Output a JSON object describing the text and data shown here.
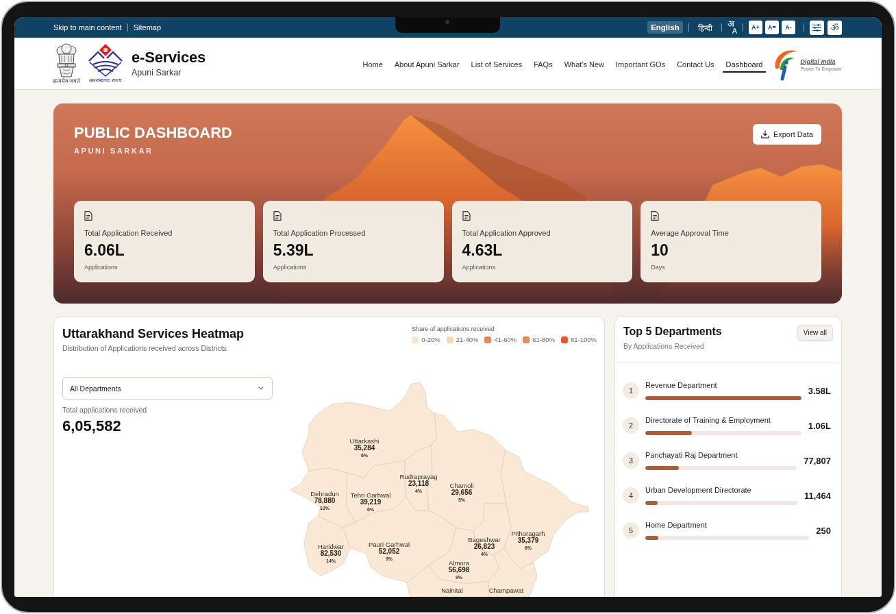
{
  "top_bar": {
    "links": [
      "Skip to main content",
      "Sitemap"
    ],
    "languages": [
      {
        "label": "English",
        "selected": true
      },
      {
        "label": "हिन्दी",
        "selected": false
      }
    ],
    "script_toggle": [
      "अ",
      "A"
    ],
    "font_size_buttons": [
      "A+",
      "A=",
      "A-"
    ],
    "accessibility_glyph": "ॐ"
  },
  "header": {
    "emblem_motto": "सत्यमेव जयते",
    "state_logo_caption": "उत्तराखण्ड राज्य",
    "title": "e-Services",
    "subtitle": "Apuni Sarkar",
    "nav": [
      {
        "label": "Home",
        "selected": false
      },
      {
        "label": "About Apuni Sarkar",
        "selected": false
      },
      {
        "label": "List of Services",
        "selected": false
      },
      {
        "label": "FAQs",
        "selected": false
      },
      {
        "label": "What's New",
        "selected": false
      },
      {
        "label": "Important GOs",
        "selected": false
      },
      {
        "label": "Contact Us",
        "selected": false
      },
      {
        "label": "Dashboard",
        "selected": true
      }
    ],
    "partner_logo": {
      "name": "Digital India",
      "tagline": "Power To Empower"
    }
  },
  "hero": {
    "title": "PUBLIC DASHBOARD",
    "subtitle": "APUNI SARKAR",
    "export_button": "Export Data",
    "stats": [
      {
        "label": "Total Application Received",
        "value": "6.06L",
        "unit": "Applications"
      },
      {
        "label": "Total Application Processed",
        "value": "5.39L",
        "unit": "Applications"
      },
      {
        "label": "Total Application Approved",
        "value": "4.63L",
        "unit": "Applications"
      },
      {
        "label": "Average Approval Time",
        "value": "10",
        "unit": "Days"
      }
    ]
  },
  "heatmap": {
    "title": "Uttarakhand Services Heatmap",
    "subtitle": "Distribution of Applications received across Districts",
    "legend": {
      "title": "Share of applications received",
      "items": [
        {
          "label": "0-20%",
          "color": "#f8e5d2"
        },
        {
          "label": "21-40%",
          "color": "#f4d9b9"
        },
        {
          "label": "41-60%",
          "color": "#e0875d"
        },
        {
          "label": "61-80%",
          "color": "#e48a60"
        },
        {
          "label": "81-100%",
          "color": "#f1542d"
        }
      ]
    },
    "department_select": "All Departments",
    "total_label": "Total applications received",
    "total_value": "6,05,582",
    "districts": [
      {
        "name": "Uttarkashi",
        "count": "35,284",
        "share": "6%",
        "color": "#f9e9d6"
      },
      {
        "name": "Dehradun",
        "count": "78,880",
        "share": "13%",
        "color": "#f9e9d6"
      },
      {
        "name": "Tehri Garhwal",
        "count": "39,219",
        "share": "6%",
        "color": "#f9e9d6"
      },
      {
        "name": "Rudraprayag",
        "count": "23,118",
        "share": "4%",
        "color": "#f9e9d6"
      },
      {
        "name": "Chamoli",
        "count": "29,656",
        "share": "5%",
        "color": "#f9e9d6"
      },
      {
        "name": "Haridwar",
        "count": "82,530",
        "share": "14%",
        "color": "#f9e9d6"
      },
      {
        "name": "Pauri Garhwal",
        "count": "52,052",
        "share": "9%",
        "color": "#f9e9d6"
      },
      {
        "name": "Bageshwar",
        "count": "26,823",
        "share": "4%",
        "color": "#f9e9d6"
      },
      {
        "name": "Pithoragarh",
        "count": "35,379",
        "share": "6%",
        "color": "#f9e9d6"
      },
      {
        "name": "Almora",
        "count": "56,698",
        "share": "9%",
        "color": "#f9e9d6"
      },
      {
        "name": "Nainital",
        "color": "#f9e9d6"
      },
      {
        "name": "Champawat",
        "color": "#f9e9d6"
      }
    ]
  },
  "top_departments": {
    "title": "Top 5 Departments",
    "subtitle": "By Applications Received",
    "view_all": "View all",
    "items": [
      {
        "rank": "1",
        "name": "Revenue Department",
        "value": "3.58L",
        "level": 1.0
      },
      {
        "rank": "2",
        "name": "Directorate of Training & Employment",
        "value": "1.06L",
        "level": 0.3
      },
      {
        "rank": "3",
        "name": "Panchayati Raj Department",
        "value": "77,807",
        "level": 0.22
      },
      {
        "rank": "4",
        "name": "Urban Development Directorate",
        "value": "11,464",
        "level": 0.08
      },
      {
        "rank": "5",
        "name": "Home Department",
        "value": "250",
        "level": 0.08
      }
    ]
  }
}
